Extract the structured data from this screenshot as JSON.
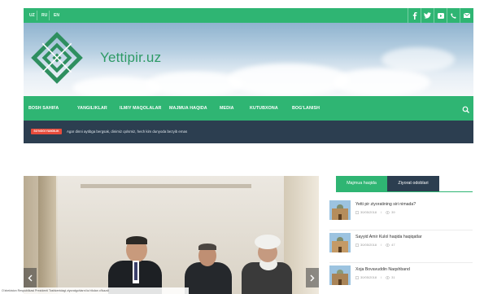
{
  "topbar": {
    "languages": [
      "UZ",
      "RU",
      "EN"
    ],
    "social_icons": [
      "facebook-icon",
      "twitter-icon",
      "youtube-icon",
      "phone-icon",
      "mail-icon"
    ],
    "color": "#2fb573"
  },
  "header": {
    "brand": "Yettipir.uz",
    "logo_icon": "yettipir-logo-icon"
  },
  "nav": {
    "items": [
      "BOSH SAHIFA",
      "YANGILIKLAR",
      "ILMIY MAQOLALAR",
      "MAJMUA HAQIDA",
      "MEDIA",
      "KUTUBXONA",
      "BOG'LANISH"
    ],
    "search_icon": "search-icon"
  },
  "ticker": {
    "badge": "SO'NGGI YANGILIK",
    "text": "Agar dinni aytibga bergsak, dinimiz qolsmiz, hech kim dunyoda bezyib emas"
  },
  "slider": {
    "caption": "O'zbekiston Respublikasi Prezidenti Toshkentdagi ziyoratgohlarni ko'rikdan o'tkazdi"
  },
  "sidebar": {
    "tabs": [
      "Majmua haqida",
      "Ziyorat odoblari"
    ],
    "posts": [
      {
        "title": "Yetti pir ziyoratining siri nimada?",
        "date": "30/05/2018",
        "views": "39"
      },
      {
        "title": "Sayyid Amir Kulol haqida haqiqatlar",
        "date": "30/05/2018",
        "views": "47"
      },
      {
        "title": "Xoja Bovavuddin Naqshband",
        "date": "30/05/2018",
        "views": "31"
      }
    ]
  },
  "colors": {
    "accent": "#2fb573",
    "dark": "#2c3e50",
    "badge": "#e74c3c"
  }
}
